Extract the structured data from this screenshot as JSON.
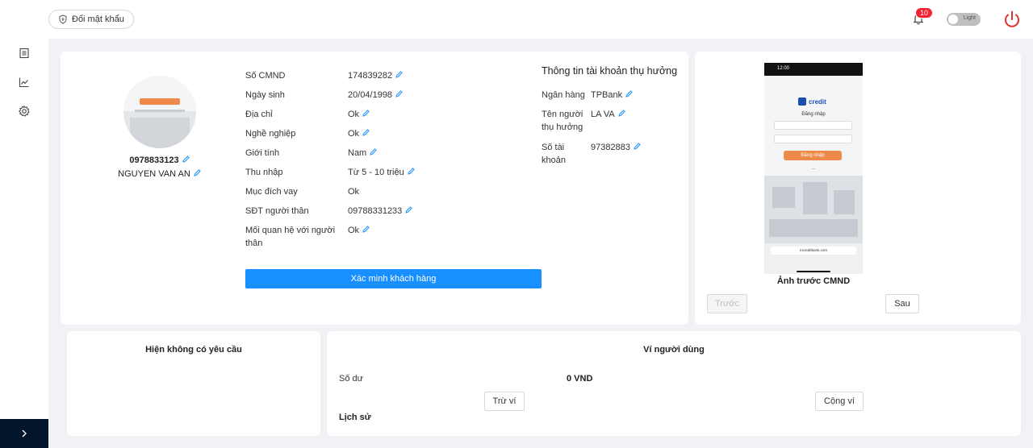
{
  "header": {
    "change_password_label": "Đổi mật khẩu",
    "notification_count": "10",
    "theme_toggle_label": "Light"
  },
  "sidebar": {
    "items": [
      {
        "icon": "document-icon"
      },
      {
        "icon": "line-chart-icon"
      },
      {
        "icon": "gear-icon"
      }
    ],
    "collapse_icon": "chevron-right-icon"
  },
  "profile": {
    "phone": "0978833123",
    "name": "NGUYEN VAN AN"
  },
  "details": [
    {
      "label": "Số CMND",
      "value": "174839282",
      "editable": true
    },
    {
      "label": "Ngày sinh",
      "value": "20/04/1998",
      "editable": true
    },
    {
      "label": "Địa chỉ",
      "value": "Ok",
      "editable": true
    },
    {
      "label": "Nghề nghiệp",
      "value": "Ok",
      "editable": true
    },
    {
      "label": "Giới tính",
      "value": "Nam",
      "editable": true
    },
    {
      "label": "Thu nhập",
      "value": "Từ 5 - 10 triệu",
      "editable": true
    },
    {
      "label": "Mục đích vay",
      "value": "Ok",
      "editable": false
    },
    {
      "label": "SĐT người thân",
      "value": "09788331233",
      "editable": true
    },
    {
      "label": "Mối quan hệ với người thân",
      "value": "Ok",
      "editable": true
    }
  ],
  "verify_button_label": "Xác minh khách hàng",
  "beneficiary": {
    "title": "Thông tin tài khoản thụ hưởng",
    "rows": [
      {
        "label": "Ngân hàng",
        "value": "TPBank"
      },
      {
        "label": "Tên người thụ hưởng",
        "value": "LA VA"
      },
      {
        "label": "Số tài khoản",
        "value": "97382883"
      }
    ]
  },
  "id_image": {
    "status_time": "12:00",
    "app_name": "credit",
    "screen_heading": "Đăng nhập",
    "login_button": "Đăng nhập",
    "url": "mcreditbank.com",
    "caption": "Ảnh trước CMND",
    "prev_label": "Trước",
    "next_label": "Sau"
  },
  "requests": {
    "empty_text": "Hiện không có yêu cầu"
  },
  "wallet": {
    "title": "Ví người dùng",
    "balance_label": "Số dư",
    "balance_value": "0 VND",
    "subtract_label": "Trừ ví",
    "add_label": "Cộng ví",
    "history_label": "Lịch sử"
  }
}
